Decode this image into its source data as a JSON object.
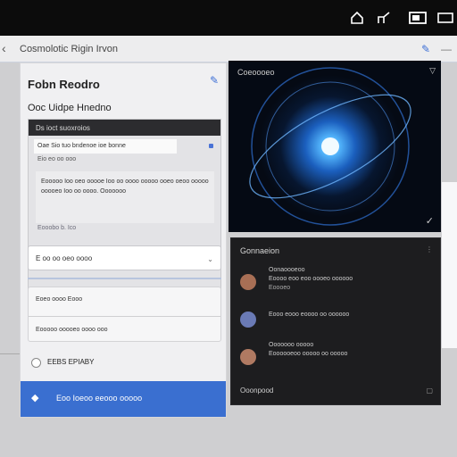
{
  "topbar": {
    "icons": [
      "home-icon",
      "share-icon",
      "window-icon",
      "tab-icon"
    ]
  },
  "addressbar": {
    "title": "Cosmolotic Rigin Irvon",
    "back_icon": "back-icon",
    "pin_icon": "pin-icon"
  },
  "left_panel": {
    "heading": "Fobn Reodro",
    "subheading": "Ooc Uidpe Hnedno",
    "card": {
      "header": "Ds ioct suoxroios",
      "field_value": "Oae Sio tuo bndenoe ioe bonne",
      "row2": "Eio eo oo ooo",
      "text": "Eooooo Ioo oeo ooooe Ioo oo oooo ooooo ooeo oeoo ooooo ooooeo Ioo oo oooo. Ooooooo",
      "footer": "Eooobo b. Ico"
    },
    "input": "E oo oo oeo oooo",
    "box": {
      "field1": "Eoeo oooo Eooo",
      "field2": "Eooooo ooooeo oooo ooo"
    },
    "checkbox_label": "EEBS EPIABY",
    "cta_label": "Eoo Ioeoo eeooo ooooo"
  },
  "image_panel": {
    "label": "Coeoooeo"
  },
  "dark_panel": {
    "title": "Gonnaeion",
    "items": [
      {
        "line1": "Oonaoooeoo",
        "line2": "Eoooo eoo eoo oooeo oooooo",
        "line3": "Eoooeo"
      },
      {
        "line1": "Eooo eooo eoooo oo oooooo",
        "line2": "",
        "line3": ""
      },
      {
        "line1": "Ooooooo ooooo",
        "line2": "Eoooooeoo ooooo oo ooooo",
        "line3": ""
      }
    ],
    "footer": "Ooonpood"
  },
  "colors": {
    "accent": "#3a6fd0",
    "dark_panel": "#1d1d1f",
    "topbar": "#0c0c0c"
  }
}
